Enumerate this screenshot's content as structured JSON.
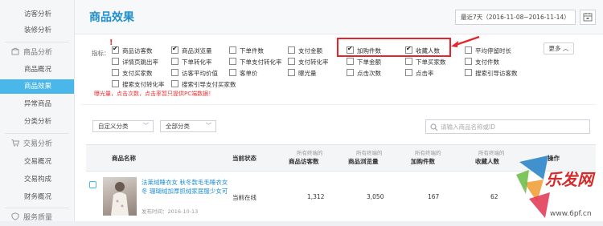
{
  "sidebar": {
    "items_top": [
      {
        "label": "访客分析"
      },
      {
        "label": "装修分析"
      }
    ],
    "group_goods": {
      "label": "商品分析"
    },
    "items_goods": [
      {
        "label": "商品概况",
        "active": false
      },
      {
        "label": "商品效果",
        "active": true
      },
      {
        "label": "异常商品",
        "active": false
      },
      {
        "label": "分类分析",
        "active": false
      }
    ],
    "group_trade": {
      "label": "交易分析"
    },
    "items_trade": [
      {
        "label": "交易概况"
      },
      {
        "label": "交易构成"
      },
      {
        "label": "财务概况"
      }
    ],
    "group_service": {
      "label": "服务质量"
    }
  },
  "header": {
    "title": "商品效果",
    "date_range": "最近7天（2016-11-08~2016-11-14）"
  },
  "indicators": {
    "label": "指标：",
    "items": [
      {
        "label": "商品访客数",
        "checked": true
      },
      {
        "label": "商品浏览量",
        "checked": true
      },
      {
        "label": "下单件数",
        "checked": false
      },
      {
        "label": "支付金额",
        "checked": false
      },
      {
        "label": "加购件数",
        "checked": true
      },
      {
        "label": "收藏人数",
        "checked": true
      },
      {
        "label": "平均停留时长",
        "checked": false
      },
      {
        "label": "详情页跳出率",
        "checked": false
      },
      {
        "label": "下单转化率",
        "checked": false
      },
      {
        "label": "下单支付转化率",
        "checked": false
      },
      {
        "label": "支付转化率",
        "checked": false
      },
      {
        "label": "下单金额",
        "checked": false
      },
      {
        "label": "下单买家数",
        "checked": false
      },
      {
        "label": "支付件数",
        "checked": false
      },
      {
        "label": "支付买家数",
        "checked": false
      },
      {
        "label": "访客平均价值",
        "checked": false
      },
      {
        "label": "客单价",
        "checked": false
      },
      {
        "label": "曝光量",
        "checked": false
      },
      {
        "label": "点击次数",
        "checked": false
      },
      {
        "label": "点击率",
        "checked": false
      },
      {
        "label": "搜索引导访客数",
        "checked": false
      },
      {
        "label": "搜索支付转化率",
        "checked": false
      },
      {
        "label": "搜索引导支付买家数",
        "checked": false
      }
    ],
    "more_label": "更多 ︿",
    "hint": "曝光量，点击次数，点击率暂只提供PC端数据！",
    "required_mark": "!"
  },
  "filters": {
    "category": "自定义分类",
    "subcategory": "全部分类",
    "search_placeholder": "请输入商品名称或ID"
  },
  "table": {
    "headers": {
      "name": "商品名称",
      "status": "当前状态",
      "visitors": "商品访客数",
      "views": "商品浏览量",
      "addcart": "加购件数",
      "fav": "收藏人数",
      "action": "操作"
    },
    "sub": "所有终端的",
    "rows": [
      {
        "name": "法莱绒睡衣女 秋冬款毛毛睡衣女冬 珊瑚绒加厚抓绒家居服少女可",
        "pub_label": "发布时间：2016-10-13",
        "status": "当前在线",
        "visitors": "1,312",
        "views": "3,050",
        "addcart": "167",
        "fav": "62"
      }
    ]
  },
  "watermark": {
    "text": "乐发网",
    "url": "www.6pf.cn"
  },
  "colors": {
    "accent": "#4ab7ea",
    "title": "#1f8fcf",
    "highlight": "#e8242b"
  }
}
